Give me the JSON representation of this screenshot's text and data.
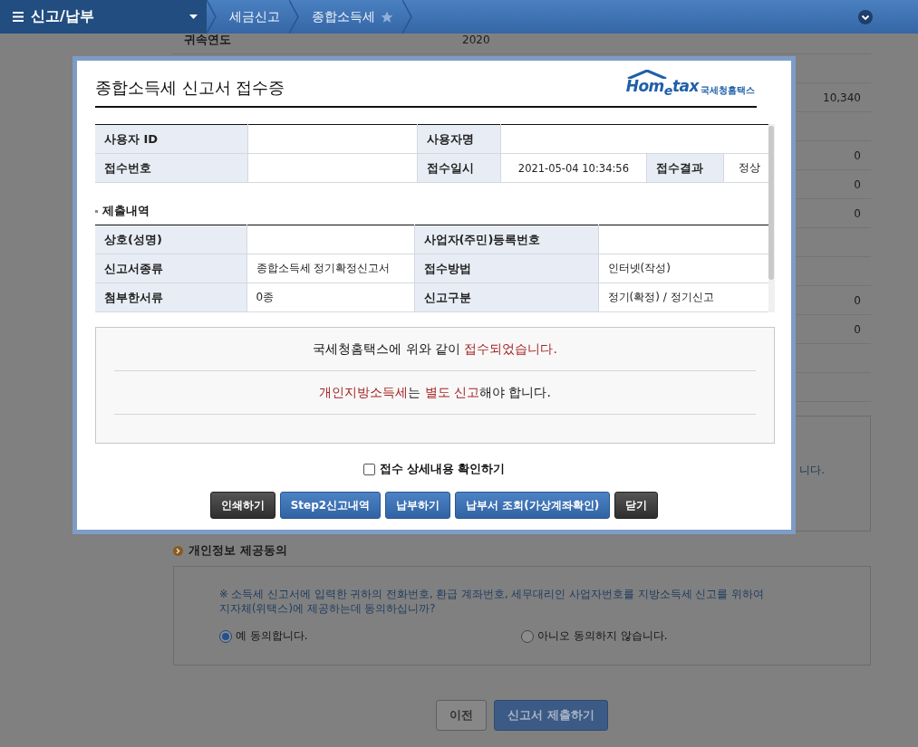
{
  "nav": {
    "menu_title": "신고/납부",
    "breadcrumbs": [
      {
        "label": "세금신고"
      },
      {
        "label": "종합소득세"
      }
    ]
  },
  "background": {
    "rows": [
      {
        "label": "귀속연도",
        "value": "2020"
      },
      {},
      {
        "value": "10,340"
      },
      {},
      {
        "value": "0"
      },
      {
        "value": "0"
      },
      {
        "value": "0"
      },
      {},
      {},
      {
        "value": "0"
      },
      {
        "value": "0"
      },
      {},
      {}
    ],
    "notice_fragment": "니다.",
    "consent": {
      "title": "개인정보 제공동의",
      "text": "※ 소득세 신고서에 입력한 귀하의 전화번호, 환급 계좌번호, 세무대리인 사업자번호를 지방소득세 신고를 위하여\n지자체(위택스)에 제공하는데 동의하십니까?",
      "options": [
        {
          "label": "예 동의합니다.",
          "selected": true
        },
        {
          "label": "아니오 동의하지 않습니다.",
          "selected": false
        }
      ]
    },
    "buttons": [
      {
        "label": "이전",
        "kind": "secondary"
      },
      {
        "label": "신고서 제출하기",
        "kind": "primary"
      }
    ]
  },
  "modal": {
    "title": "종합소득세 신고서 접수증",
    "logo": {
      "text": "Hom$_{e}$tax",
      "subtitle": "국세청홈택스"
    },
    "user_table": [
      [
        {
          "kind": "label",
          "text": "사용자 ID"
        },
        {
          "kind": "value"
        },
        {
          "kind": "label",
          "text": "사용자명"
        },
        {
          "kind": "value"
        }
      ],
      [
        {
          "kind": "label",
          "text": "접수번호"
        },
        {
          "kind": "value"
        },
        {
          "kind": "label",
          "text": "접수일시"
        },
        {
          "kind": "value",
          "text": "2021-05-04 10:34:56"
        },
        {
          "kind": "label",
          "text": "접수결과"
        },
        {
          "kind": "value",
          "text": "정상"
        }
      ]
    ],
    "section_title": "제출내역",
    "detail_table": [
      [
        {
          "kind": "label",
          "text": "상호(성명)"
        },
        {
          "kind": "value"
        },
        {
          "kind": "label",
          "text": "사업자(주민)등록번호"
        },
        {
          "kind": "value"
        }
      ],
      [
        {
          "kind": "label",
          "text": "신고서종류"
        },
        {
          "kind": "value",
          "text": "종합소득세 정기확정신고서"
        },
        {
          "kind": "label",
          "text": "접수방법"
        },
        {
          "kind": "value",
          "text": "인터넷(작성)"
        }
      ],
      [
        {
          "kind": "label",
          "text": "첨부한서류"
        },
        {
          "kind": "value",
          "text": "0종"
        },
        {
          "kind": "label",
          "text": "신고구분"
        },
        {
          "kind": "value",
          "text": "정기(확정) / 정기신고"
        }
      ]
    ],
    "messages": [
      "국세청홈택스에 위와 같이 **접수되었습니다.**",
      "**개인지방소득세**는 **별도 신고**해야 합니다."
    ],
    "checkbox": {
      "label": "접수 상세내용 확인하기",
      "checked": false
    },
    "buttons": [
      {
        "label": "인쇄하기",
        "kind": "dark"
      },
      {
        "label": "Step2신고내역",
        "kind": "blue"
      },
      {
        "label": "납부하기",
        "kind": "blue"
      },
      {
        "label": "납부서 조회(가상계좌확인)",
        "kind": "blue"
      },
      {
        "label": "닫기",
        "kind": "dark"
      }
    ]
  }
}
